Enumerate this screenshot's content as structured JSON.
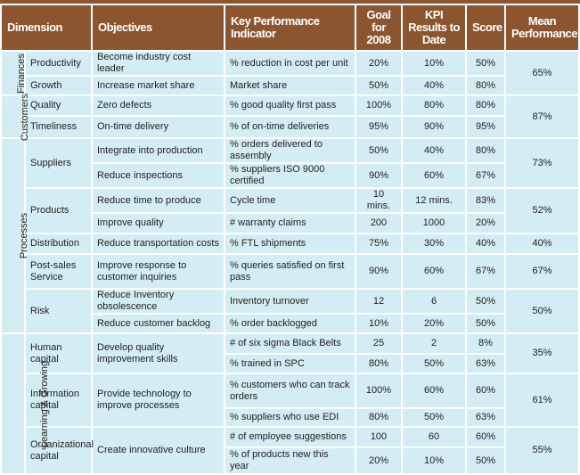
{
  "header": {
    "dimension": "Dimension",
    "objectives": "Objectives",
    "kpi": "Key Performance Indicator",
    "goal": "Goal for 2008",
    "results": "KPI Results to Date",
    "score": "Score",
    "mean": "Mean Performance"
  },
  "colors": {
    "header_bg": "#8b5530",
    "cell_bg": "#d4ecf3"
  },
  "rows": [
    {
      "group": "Finances",
      "groupSpan": 2,
      "dimension": "Productivity",
      "dimSpan": 1,
      "objective": "Become industry cost leader",
      "objSpan": 1,
      "kpi": "% reduction in cost per unit",
      "goal": "20%",
      "result": "10%",
      "score": "50%",
      "mean": "65%",
      "meanSpan": 2,
      "h": 25
    },
    {
      "dimension": "Growth",
      "dimSpan": 1,
      "objective": "Increase market share",
      "objSpan": 1,
      "kpi": "Market share",
      "goal": "50%",
      "result": "40%",
      "score": "80%",
      "h": 22
    },
    {
      "group": "Customers",
      "groupSpan": 2,
      "dimension": "Quality",
      "dimSpan": 1,
      "objective": "Zero defects",
      "objSpan": 1,
      "kpi": "% good quality first pass",
      "goal": "100%",
      "result": "80%",
      "score": "80%",
      "mean": "87%",
      "meanSpan": 2,
      "h": 23
    },
    {
      "dimension": "Timeliness",
      "dimSpan": 1,
      "objective": "On-time delivery",
      "objSpan": 1,
      "kpi": "% of on-time deliveries",
      "goal": "95%",
      "result": "90%",
      "score": "95%",
      "h": 25
    },
    {
      "group": "Processes",
      "groupSpan": 8,
      "dimension": "Suppliers",
      "dimSpan": 2,
      "objective": "Integrate into production",
      "objSpan": 1,
      "kpi": "% orders delivered to assembly",
      "goal": "50%",
      "result": "40%",
      "score": "80%",
      "mean": "73%",
      "meanSpan": 2,
      "h": 23
    },
    {
      "objective": "Reduce inspections",
      "objSpan": 1,
      "kpi": "% suppliers ISO 9000 certified",
      "goal": "90%",
      "result": "60%",
      "score": "67%",
      "h": 23
    },
    {
      "dimension": "Products",
      "dimSpan": 2,
      "objective": "Reduce time to produce",
      "objSpan": 1,
      "kpi": "Cycle time",
      "goal": "10 mins.",
      "result": "12 mins.",
      "score": "83%",
      "mean": "52%",
      "meanSpan": 2,
      "h": 23
    },
    {
      "objective": "Improve quality",
      "objSpan": 1,
      "kpi": "# warranty claims",
      "goal": "200",
      "result": "1000",
      "score": "20%",
      "h": 23
    },
    {
      "dimension": "Distribution",
      "dimSpan": 1,
      "objective": "Reduce transportation costs",
      "objSpan": 1,
      "kpi": "% FTL shipments",
      "goal": "75%",
      "result": "30%",
      "score": "40%",
      "mean": "40%",
      "meanSpan": 1,
      "h": 23
    },
    {
      "dimension": "Post-sales Service",
      "dimSpan": 1,
      "objective": "Improve response to customer inquiries",
      "objSpan": 1,
      "kpi": "% queries satisfied on first pass",
      "goal": "90%",
      "result": "60%",
      "score": "67%",
      "mean": "67%",
      "meanSpan": 1,
      "h": 39
    },
    {
      "dimension": "Risk",
      "dimSpan": 2,
      "objective": "Reduce Inventory obsolescence",
      "objSpan": 1,
      "kpi": "Inventory turnover",
      "goal": "12",
      "result": "6",
      "score": "50%",
      "mean": "50%",
      "meanSpan": 2,
      "h": 23
    },
    {
      "objective": "Reduce customer backlog",
      "objSpan": 1,
      "kpi": "% order backlogged",
      "goal": "10%",
      "result": "20%",
      "score": "50%",
      "h": 22
    },
    {
      "group": "Learning & Growing",
      "groupSpan": 6,
      "dimension": "Human capital",
      "dimSpan": 2,
      "objective": "Develop quality improvement skills",
      "objSpan": 2,
      "kpi": "# of six sigma Black Belts",
      "goal": "25",
      "result": "2",
      "score": "8%",
      "mean": "35%",
      "meanSpan": 2,
      "h": 23
    },
    {
      "kpi": "% trained in SPC",
      "goal": "80%",
      "result": "50%",
      "score": "63%",
      "h": 22
    },
    {
      "dimension": "Information capital",
      "dimSpan": 2,
      "objective": "Provide technology to improve processes",
      "objSpan": 2,
      "kpi": "% customers who can track orders",
      "goal": "100%",
      "result": "60%",
      "score": "60%",
      "mean": "61%",
      "meanSpan": 2,
      "h": 39
    },
    {
      "kpi": "% suppliers who use EDI",
      "goal": "80%",
      "result": "50%",
      "score": "63%",
      "h": 21
    },
    {
      "dimension": "Organizational capital",
      "dimSpan": 2,
      "objective": "Create innovative culture",
      "objSpan": 2,
      "kpi": "# of employee suggestions",
      "goal": "100",
      "result": "60",
      "score": "60%",
      "mean": "55%",
      "meanSpan": 2,
      "h": 23
    },
    {
      "kpi": "% of products new this year",
      "goal": "20%",
      "result": "10%",
      "score": "50%",
      "h": 30
    }
  ]
}
